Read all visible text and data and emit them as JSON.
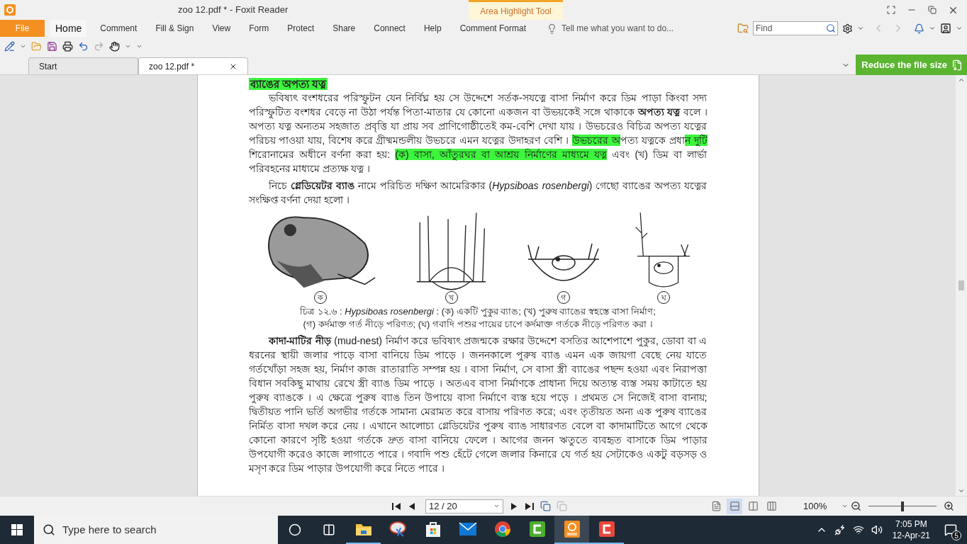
{
  "window": {
    "title": "zoo 12.pdf * - Foxit Reader",
    "context_tab": "Area Highlight Tool"
  },
  "file_menu": {
    "label": "File"
  },
  "ribbon_tabs": [
    {
      "label": "Home",
      "selected": true
    },
    {
      "label": "Comment",
      "selected": false
    },
    {
      "label": "Fill & Sign",
      "selected": false
    },
    {
      "label": "View",
      "selected": false
    },
    {
      "label": "Form",
      "selected": false
    },
    {
      "label": "Protect",
      "selected": false
    },
    {
      "label": "Share",
      "selected": false
    },
    {
      "label": "Connect",
      "selected": false
    },
    {
      "label": "Help",
      "selected": false
    },
    {
      "label": "Comment Format",
      "selected": false
    }
  ],
  "tell_me": {
    "placeholder": "Tell me what you want to do..."
  },
  "find": {
    "placeholder": "Find"
  },
  "doc_tabs": [
    {
      "label": "Start",
      "selected": false
    },
    {
      "label": "zoo 12.pdf *",
      "selected": true
    }
  ],
  "promo_button": {
    "label": "Reduce the file size"
  },
  "document": {
    "heading": "ব্যাঙের অপত্য যত্ন",
    "paragraphs": [
      {
        "segments": [
          {
            "text": "ভবিষ্যৎ বংশধরের পরিস্ফুটন যেন নির্বিঘ্ন হয় সে উদ্দেশে সর্তক-সযত্নে বাসা নির্মাণ করে ডিম পাড়া কিংবা সদ্য পরিস্ফুটিত বংশধর বেড়ে না উঠা পর্যন্ত পিতা-মাতার যে কোনো একজন বা উভয়কেই সঙ্গে থাকাকে **অপত্য যত্ন** বলে । অপত্য যত্ন অন্যতম সহজাত প্রবৃত্তি যা প্রায় সব প্রাণিগোষ্ঠীতেই কম-বেশি দেখা যায় । উভচরেও বিচিত্র অপত্য যত্নের পরিচয় পাওয়া যায়, বিশেষ করে গ্রীষ্মমন্ডলীয় উভচরে এমন যত্নের উদাহরণ বেশি । ",
            "highlighted": false
          },
          {
            "text": "উভচরের অ",
            "highlighted": true
          },
          {
            "text": "পত্য যত্নকে প্রধা",
            "highlighted": false
          },
          {
            "text": "ন দুটি",
            "highlighted": true
          },
          {
            "text": " শিরোনামের অধীনে বর্ণনা করা হয়: ",
            "highlighted": false
          },
          {
            "text": "(ক) বাসা, আঁতুরঘর বা আশ্রয় নির্মাণের মাধ্যমে যত্ন",
            "highlighted": true
          },
          {
            "text": " এবং (খ) ডিম বা লার্ভা পরিবহনের মাধ্যমে প্রত্যক্ষ যত্ন ।",
            "highlighted": false
          }
        ]
      },
      {
        "segments": [
          {
            "text": "নিচে **গ্লেডিয়েটর ব্যাঙ** নামে পরিচিত দক্ষিণ আমেরিকার (*Hypsiboas rosenbergi*) গেছো ব্যাঙের অপত্য যত্নের সংক্ষিপ্ত বর্ণনা দেয়া হলো ।",
            "highlighted": false
          }
        ]
      }
    ],
    "figure": {
      "panels": [
        {
          "kind": "frog",
          "label": "ক"
        },
        {
          "kind": "reed-nest",
          "label": "খ"
        },
        {
          "kind": "pool-frog",
          "label": "গ"
        },
        {
          "kind": "pit-frog",
          "label": "ঘ"
        }
      ],
      "caption": [
        "চিত্র ১২.৬ : *Hypsiboas rosenbergi* : (ক) একটি পুকুর ব্যাঙ; (খ) পুরুষ ব্যাঙের স্বহস্তে বাসা নির্মাণ;",
        "(গ) কর্দমাক্ত গর্ত নীড়ে পরিণত; (ঘ) গবাদি পশুর পায়ের চাপে কর্দমাক্ত গর্তকে নীড়ে পরিণত করা ।"
      ]
    },
    "paragraphs_after": [
      {
        "segments": [
          {
            "text": "**কাদা-মাটির নীড়** (mud-nest) নির্মাণ করে ভবিষ্যৎ প্রজন্মকে রক্ষার উদ্দেশে বসতির আশেপাশে পুকুর, ডোবা বা এ ধরনের স্থায়ী জলার পাড়ে বাসা বানিয়ে ডিম পাড়ে । জননকালে পুরুষ ব্যাঙ এমন এক জায়গা বেছে নেয় যাতে গর্তখোঁড়া সহজ হয়, নির্মাণ কাজ রাতারাতি সম্পন্ন হয় । বাসা নির্মাণ, সে বাসা স্ত্রী ব্যাঙের পছন্দ হওয়া এবং নিরাপত্তা বিধান সবকিছু মাথায় রেখে স্ত্রী ব্যাঙ ডিম পাড়ে । অতএব বাসা নির্মাণকে প্রাধান্য দিয়ে অত্যন্ত ব্যস্ত সময় কাটাতে হয় পুরুষ ব্যাঙকে । এ ক্ষেত্রে পুরুষ ব্যাঙ তিন উপায়ে বাসা নির্মাণে ব্যস্ত হয়ে পড়ে । প্রথমত সে নিজেই বাসা বানায়; দ্বিতীয়ত পানি ভর্তি অগভীর গর্তকে সামান্য মেরামত করে বাসায় পরিণত করে; এবং তৃতীয়ত অন্য এক পুরুষ ব্যাঙের নির্মিত বাসা দখল করে নেয় । এখানে আলোচ্য গ্লেডিয়েটর পুরুষ ব্যাঙ সাধারণত বেলে বা কাদামাটিতে আগে থেকে কোনো কারণে সৃষ্টি হওয়া গর্তকে দ্রুত বাসা বানিয়ে ফেলে । আগের জনন ঋতুতে ব্যবহৃত বাসাকে ডিম পাড়ার উপযোগী করেও কাজে লাগাতে পারে । গবাদি পশু হেঁটে গেলে জলার কিনারে যে গর্ত হয় সেটাকেও একটু বড়সড় ও মসৃণ করে ডিম পাড়ার উপযোগী করে নিতে পারে ।",
            "highlighted": false
          }
        ]
      }
    ]
  },
  "status_bar": {
    "page": "12 / 20",
    "view_modes": [
      {
        "selected": false
      },
      {
        "selected": true
      },
      {
        "selected": false
      },
      {
        "selected": false
      }
    ],
    "zoom": "100%",
    "zoom_slider": {
      "level": 0.5
    }
  },
  "taskbar": {
    "search_placeholder": "Type here to search",
    "apps": [
      {
        "kind": "explorer",
        "running": true,
        "selected": false
      },
      {
        "kind": "snipping",
        "running": false,
        "selected": false
      },
      {
        "kind": "store",
        "running": false,
        "selected": false
      },
      {
        "kind": "mail",
        "running": false,
        "selected": false
      },
      {
        "kind": "chrome",
        "running": false,
        "selected": false
      },
      {
        "kind": "camtasia-green",
        "running": false,
        "selected": false
      },
      {
        "kind": "foxit",
        "running": true,
        "selected": true
      },
      {
        "kind": "camtasia-red",
        "running": true,
        "selected": false
      }
    ],
    "time": "7:05 PM",
    "date": "12-Apr-21",
    "notifications": "5"
  }
}
